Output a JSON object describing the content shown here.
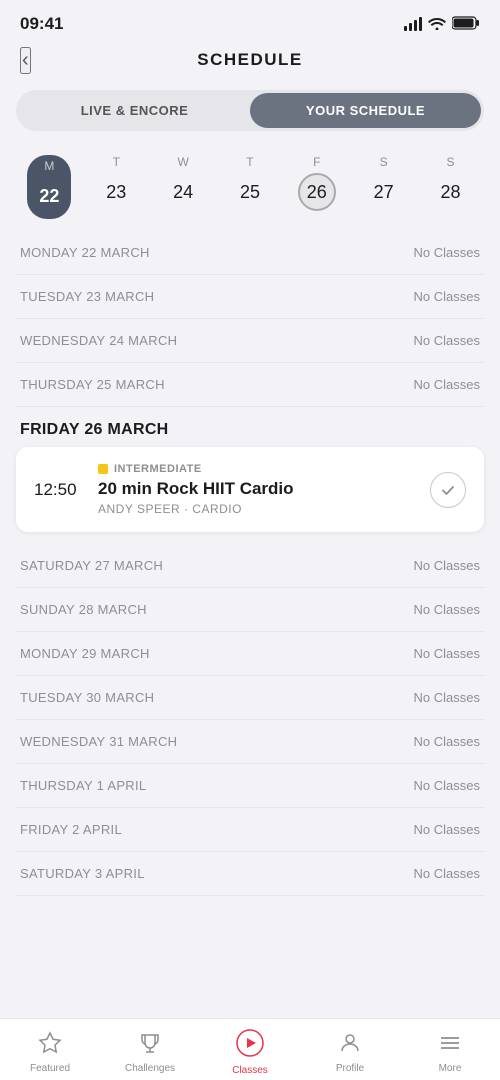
{
  "statusBar": {
    "time": "09:41"
  },
  "header": {
    "backLabel": "<",
    "title": "SCHEDULE"
  },
  "tabs": [
    {
      "id": "live",
      "label": "LIVE & ENCORE",
      "active": false
    },
    {
      "id": "your",
      "label": "YOUR SCHEDULE",
      "active": true
    }
  ],
  "week": [
    {
      "letter": "M",
      "number": "22",
      "state": "today"
    },
    {
      "letter": "T",
      "number": "23",
      "state": "normal"
    },
    {
      "letter": "W",
      "number": "24",
      "state": "normal"
    },
    {
      "letter": "T",
      "number": "25",
      "state": "normal"
    },
    {
      "letter": "F",
      "number": "26",
      "state": "selected"
    },
    {
      "letter": "S",
      "number": "27",
      "state": "normal"
    },
    {
      "letter": "S",
      "number": "28",
      "state": "normal"
    }
  ],
  "schedule": [
    {
      "type": "row",
      "label": "MONDAY 22 MARCH",
      "status": "No Classes"
    },
    {
      "type": "row",
      "label": "TUESDAY 23 MARCH",
      "status": "No Classes"
    },
    {
      "type": "row",
      "label": "WEDNESDAY 24 MARCH",
      "status": "No Classes"
    },
    {
      "type": "row",
      "label": "THURSDAY 25 MARCH",
      "status": "No Classes"
    },
    {
      "type": "header",
      "label": "FRIDAY 26 MARCH"
    },
    {
      "type": "class",
      "time": "12:50",
      "level": "INTERMEDIATE",
      "name": "20 min Rock HIIT Cardio",
      "instructor": "ANDY SPEER",
      "category": "CARDIO",
      "checked": true
    },
    {
      "type": "row",
      "label": "SATURDAY 27 MARCH",
      "status": "No Classes"
    },
    {
      "type": "row",
      "label": "SUNDAY 28 MARCH",
      "status": "No Classes"
    },
    {
      "type": "row",
      "label": "MONDAY 29 MARCH",
      "status": "No Classes"
    },
    {
      "type": "row",
      "label": "TUESDAY 30 MARCH",
      "status": "No Classes"
    },
    {
      "type": "row",
      "label": "WEDNESDAY 31 MARCH",
      "status": "No Classes"
    },
    {
      "type": "row",
      "label": "THURSDAY 1 APRIL",
      "status": "No Classes"
    },
    {
      "type": "row",
      "label": "FRIDAY 2 APRIL",
      "status": "No Classes"
    },
    {
      "type": "row",
      "label": "SATURDAY 3 APRIL",
      "status": "No Classes"
    }
  ],
  "nav": [
    {
      "id": "featured",
      "label": "Featured",
      "icon": "☆",
      "active": false
    },
    {
      "id": "challenges",
      "label": "Challenges",
      "icon": "🏆",
      "active": false
    },
    {
      "id": "classes",
      "label": "Classes",
      "icon": "▶",
      "active": true
    },
    {
      "id": "profile",
      "label": "Profile",
      "icon": "👤",
      "active": false
    },
    {
      "id": "more",
      "label": "More",
      "icon": "≡",
      "active": false
    }
  ]
}
